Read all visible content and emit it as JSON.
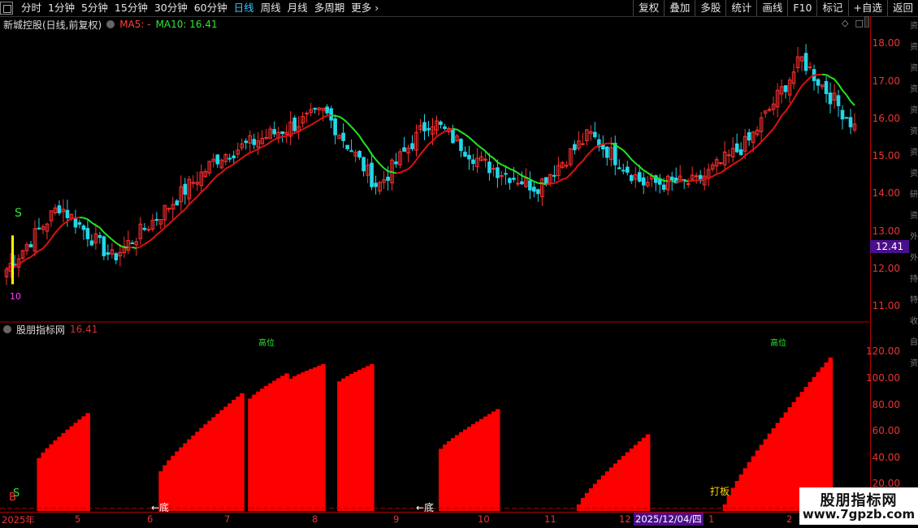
{
  "toolbar": {
    "periods": [
      "分时",
      "1分钟",
      "5分钟",
      "15分钟",
      "30分钟",
      "60分钟",
      "日线",
      "周线",
      "月线",
      "多周期",
      "更多"
    ],
    "active_period": "日线",
    "more_icon": "chevron-right-icon",
    "right_buttons": [
      "复权",
      "叠加",
      "多股",
      "统计",
      "画线",
      "F10",
      "标记",
      "+自选",
      "返回"
    ]
  },
  "main": {
    "title": "新城控股(日线,前复权)",
    "ma5_label": "MA5: -",
    "ma10_label": "MA10: 16.41",
    "current_price": "12.41",
    "low_label": "10",
    "signal_label": "S",
    "colors": {
      "up": "#ff3030",
      "down": "#23d6e8",
      "ma5": "#e01010",
      "ma10": "#22e622",
      "axis": "#e33333",
      "tag": "#4a0f8a"
    }
  },
  "indicator": {
    "title": "股朋指标网",
    "value": "16.41",
    "labels": [
      "←底",
      "←底",
      "打板"
    ],
    "top_labels": [
      "高位",
      "高位"
    ],
    "signal_b": "B",
    "signal_s": "S",
    "ticks": [
      "120.00",
      "100.00",
      "80.00",
      "60.00",
      "40.00",
      "20.00"
    ]
  },
  "xaxis": {
    "labels": [
      "2025年",
      "5",
      "6",
      "7",
      "8",
      "9",
      "10",
      "11",
      "12",
      "2025/12/04/四",
      "1",
      "2"
    ],
    "selected": "2025/12/04/四"
  },
  "side_text": [
    "资",
    "资",
    "资",
    "资",
    "资",
    "资",
    "资",
    "资",
    "研",
    "资",
    "外",
    "外",
    "持",
    "特",
    "收",
    "自",
    "资"
  ],
  "watermark": {
    "title": "股朋指标网",
    "url": "www.7gpzb.com"
  },
  "chart_data": [
    {
      "type": "candlestick",
      "title": "新城控股(日线,前复权)",
      "ylim": [
        10.7,
        18.4
      ],
      "yticks": [
        18.0,
        17.0,
        16.0,
        15.0,
        14.0,
        13.0,
        12.0,
        11.0
      ],
      "keypoints": [
        {
          "x": "2025年",
          "close": 12.0
        },
        {
          "x": "5",
          "close": 13.7
        },
        {
          "x": "6",
          "close": 12.3
        },
        {
          "x": "7",
          "close": 13.6
        },
        {
          "x": "7-mid",
          "close": 15.0
        },
        {
          "x": "8",
          "close": 15.6
        },
        {
          "x": "8-late",
          "close": 16.2
        },
        {
          "x": "9",
          "close": 14.2
        },
        {
          "x": "10",
          "close": 16.0
        },
        {
          "x": "10-late",
          "close": 14.8
        },
        {
          "x": "11",
          "close": 14.2
        },
        {
          "x": "11-late",
          "close": 15.6
        },
        {
          "x": "12",
          "close": 14.3
        },
        {
          "x": "1",
          "close": 14.3
        },
        {
          "x": "1-late",
          "close": 15.4
        },
        {
          "x": "2",
          "close": 17.6
        },
        {
          "x": "end",
          "close": 15.8
        }
      ],
      "ma10_endpoint": 16.41
    },
    {
      "type": "bar",
      "title": "股朋指标网",
      "ylim": [
        0,
        130
      ],
      "yticks": [
        120,
        100,
        80,
        60,
        40,
        20
      ],
      "blocks": [
        {
          "from_index": 8,
          "to_index": 20,
          "start": 40,
          "end": 74
        },
        {
          "from_index": 38,
          "to_index": 58,
          "start": 30,
          "end": 89
        },
        {
          "from_index": 60,
          "to_index": 69,
          "start": 85,
          "end": 104
        },
        {
          "from_index": 70,
          "to_index": 78,
          "start": 100,
          "end": 111
        },
        {
          "from_index": 82,
          "to_index": 90,
          "start": 98,
          "end": 111
        },
        {
          "from_index": 107,
          "to_index": 121,
          "start": 47,
          "end": 77
        },
        {
          "from_index": 141,
          "to_index": 158,
          "start": 5,
          "end": 58
        },
        {
          "from_index": 177,
          "to_index": 203,
          "start": 5,
          "end": 116
        }
      ]
    }
  ]
}
